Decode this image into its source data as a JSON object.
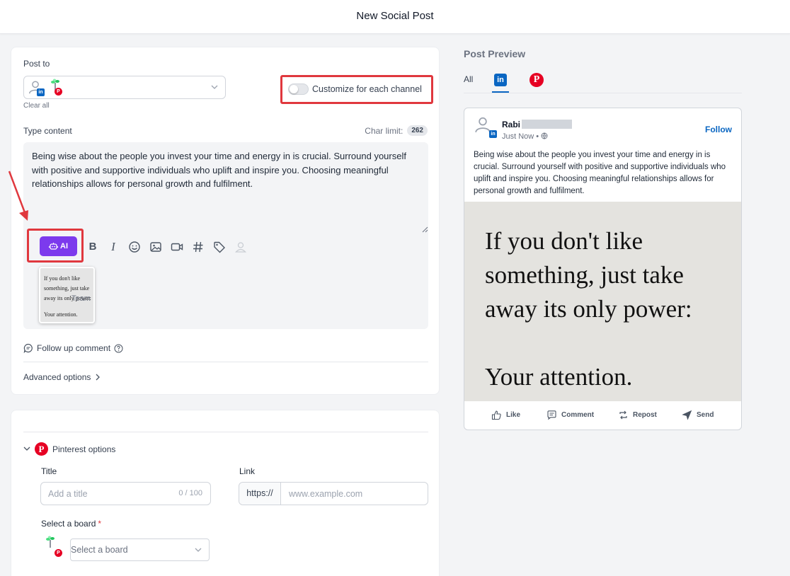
{
  "header": {
    "title": "New Social Post"
  },
  "composer": {
    "post_to_label": "Post to",
    "clear_all": "Clear all",
    "customize_label": "Customize for each channel",
    "type_content_label": "Type content",
    "char_limit_label": "Char limit:",
    "char_limit_value": "262",
    "content_text": "Being wise about the people you invest your time and energy in is crucial. Surround yourself with positive and supportive individuals who uplift and inspire you. Choosing meaningful relationships allows for personal growth and fulfilment.",
    "ai_label": "AI",
    "toolbar_icons": [
      "bold-icon",
      "italic-icon",
      "emoji-icon",
      "image-icon",
      "video-icon",
      "hashtag-icon",
      "tag-icon",
      "mention-icon"
    ],
    "thumbnail_lines": [
      "If you don't like",
      "something, just take",
      "away its only power:",
      "Your attention."
    ],
    "thumbnail_overlay": "Team",
    "follow_up_label": "Follow up comment",
    "advanced_label": "Advanced options"
  },
  "pinterest": {
    "header": "Pinterest options",
    "title_label": "Title",
    "title_placeholder": "Add a title",
    "title_count": "0 / 100",
    "link_label": "Link",
    "link_prefix": "https://",
    "link_placeholder": "www.example.com",
    "board_label": "Select a board",
    "board_required": "*",
    "board_placeholder": "Select a board"
  },
  "preview": {
    "title": "Post Preview",
    "tab_all": "All",
    "tab_linkedin_glyph": "in",
    "tab_pinterest_glyph": "P",
    "author": "Rabi",
    "time": "Just Now •",
    "follow": "Follow",
    "text": "Being wise about the people you invest your time and energy in is crucial. Surround yourself with positive and supportive individuals who uplift and inspire you. Choosing meaningful relationships allows for personal growth and fulfilment.",
    "image_lines": [
      "If you don't like",
      "something, just take",
      "away its only power:",
      "Your attention."
    ],
    "actions": [
      "Like",
      "Comment",
      "Repost",
      "Send"
    ]
  },
  "colors": {
    "accent_purple": "#7c3aed",
    "linkedin_blue": "#0a66c2",
    "pinterest_red": "#e60023",
    "annotation_red": "#e0383e"
  }
}
